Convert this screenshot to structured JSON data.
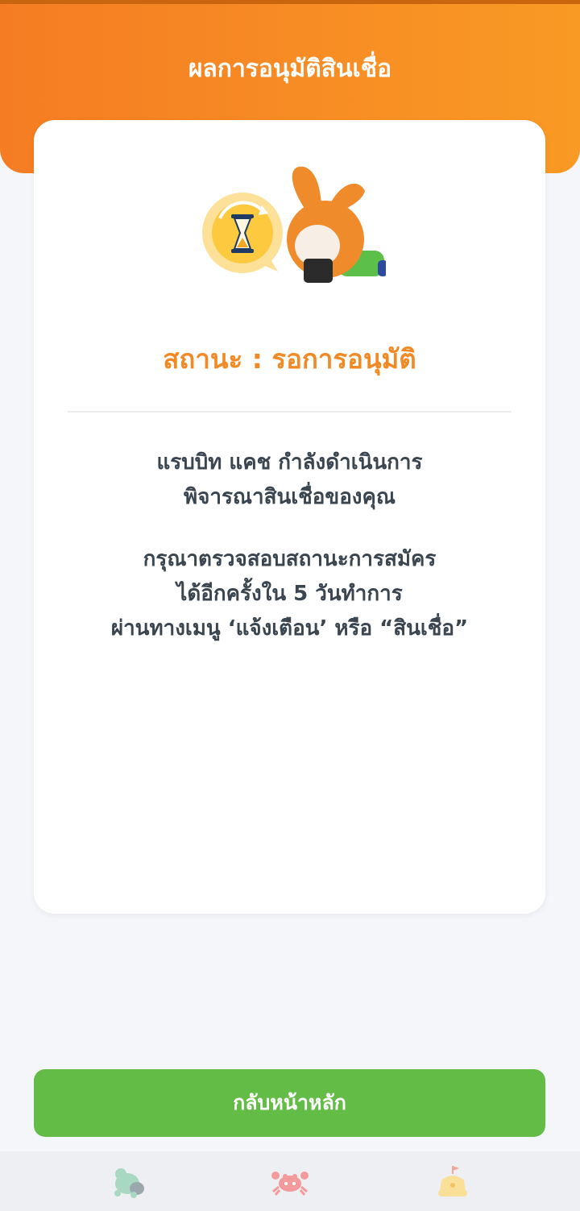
{
  "header": {
    "title": "ผลการอนุมัติสินเชื่อ"
  },
  "status": {
    "text": "สถานะ : รอการอนุมัติ",
    "illustration_icon": "hourglass-rabbit-illustration"
  },
  "message": {
    "paragraph1": [
      "แรบบิท แคช กำลังดำเนินการ",
      "พิจารณาสินเชื่อของคุณ"
    ],
    "paragraph2": [
      "กรุณาตรวจสอบสถานะการสมัคร",
      "ได้อีกครั้งใน 5 วันทำการ",
      "ผ่านทางเมนู ‘แจ้งเตือน’ หรือ “สินเชื่อ”"
    ]
  },
  "button": {
    "label": "กลับหน้าหลัก"
  },
  "bottom_nav": {
    "items": [
      "turtle-icon",
      "crab-icon",
      "sandcastle-icon"
    ]
  },
  "colors": {
    "header_gradient_start": "#f57c23",
    "header_gradient_end": "#f99a24",
    "status_text": "#f18a24",
    "button": "#63bc46",
    "body_text": "#3a4550",
    "background": "#f5f6fa"
  }
}
